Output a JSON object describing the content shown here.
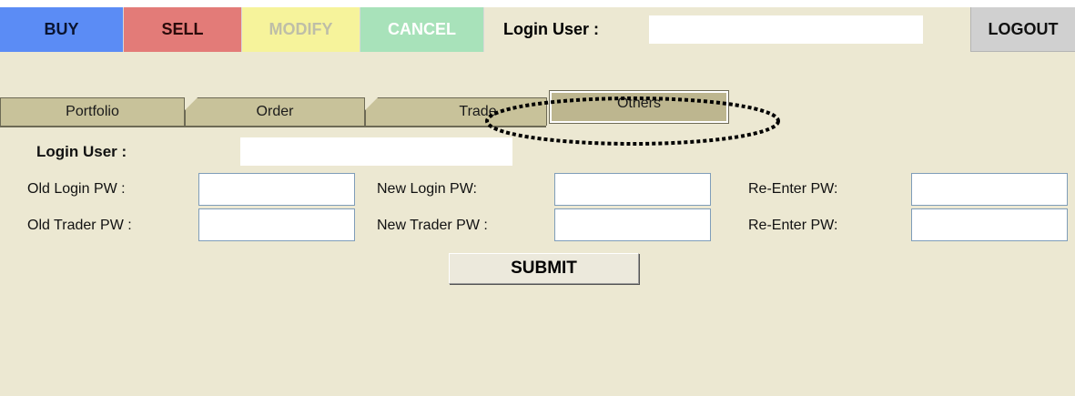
{
  "topbar": {
    "buy_label": "BUY",
    "sell_label": "SELL",
    "modify_label": "MODIFY",
    "cancel_label": "CANCEL",
    "login_user_label": "Login User :",
    "login_user_value": "",
    "logout_label": "LOGOUT"
  },
  "tabs": [
    {
      "label": "Portfolio",
      "active": false
    },
    {
      "label": "Order",
      "active": false
    },
    {
      "label": "Trade",
      "active": false
    },
    {
      "label": "Others",
      "active": true
    }
  ],
  "form": {
    "login_user_label": "Login User :",
    "login_user_value": "",
    "old_login_pw_label": "Old Login PW :",
    "new_login_pw_label": "New Login PW:",
    "reenter_login_pw_label": "Re-Enter PW:",
    "old_trader_pw_label": "Old Trader PW :",
    "new_trader_pw_label": "New Trader PW :",
    "reenter_trader_pw_label": "Re-Enter PW:",
    "submit_label": "SUBMIT"
  },
  "colors": {
    "buy": "#5b8cf5",
    "sell": "#e37b78",
    "modify": "#f6f39b",
    "cancel": "#a8e2ba",
    "panel_background": "#ece8d2",
    "tab_background": "#c8c29a"
  }
}
